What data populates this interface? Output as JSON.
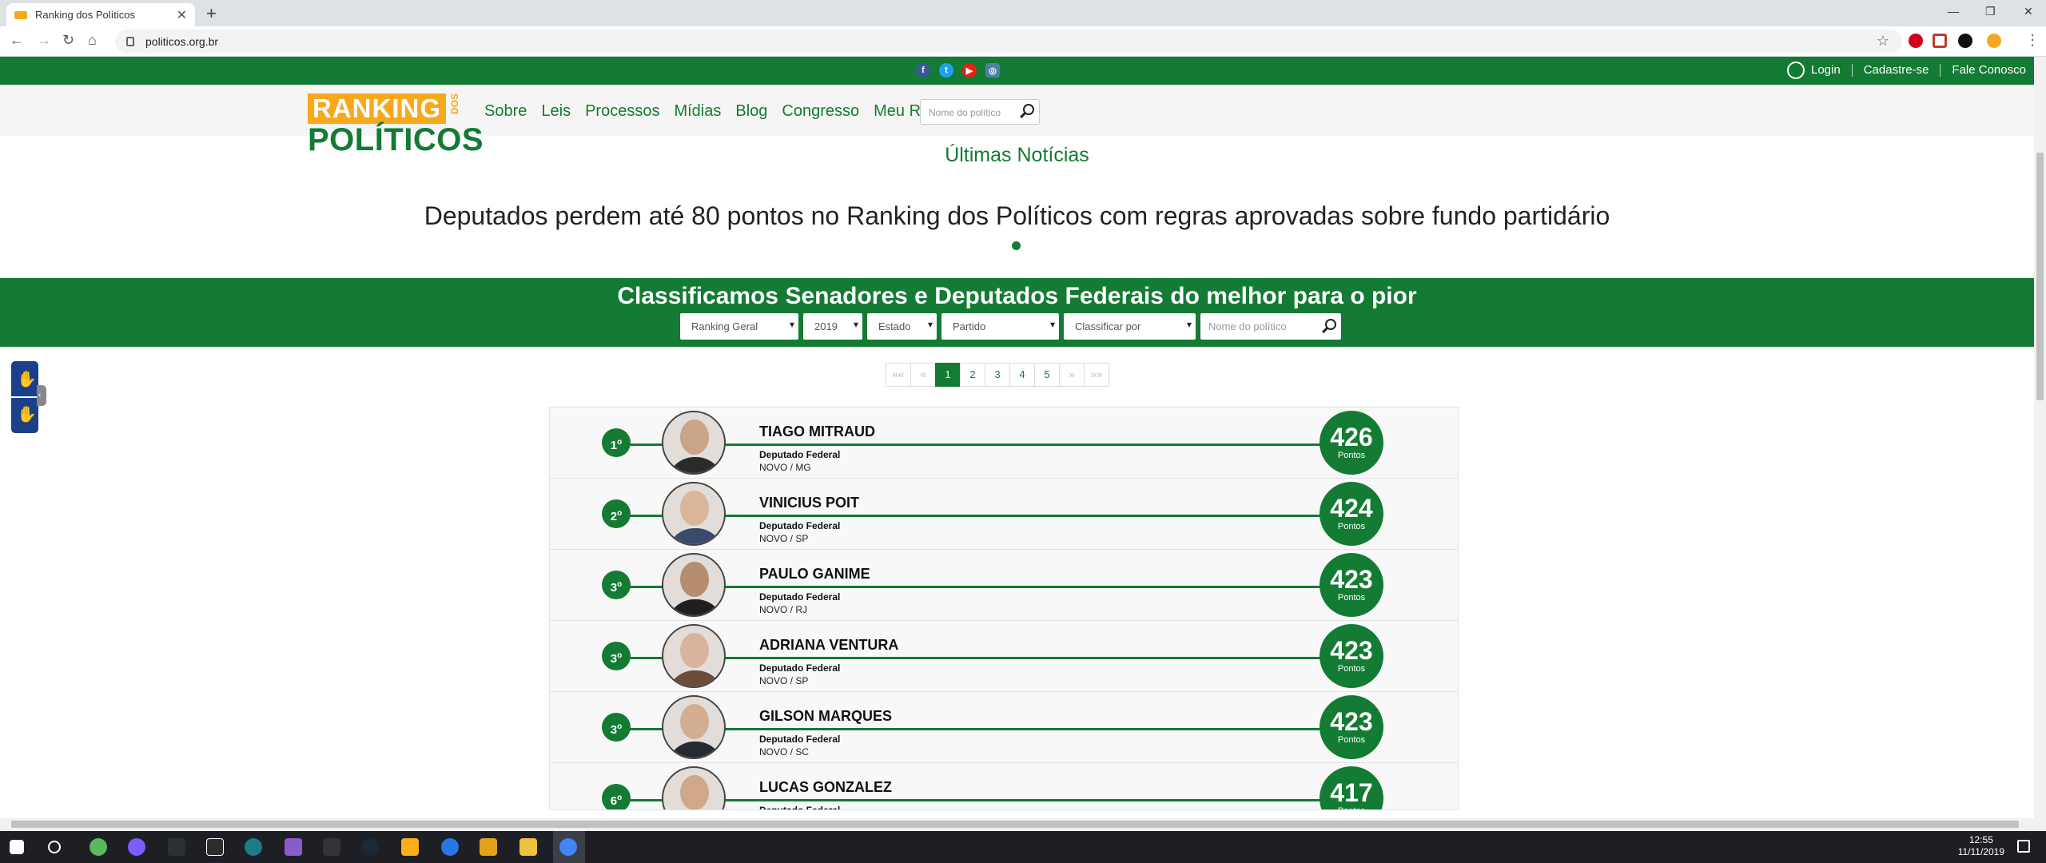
{
  "browser": {
    "tab_title": "Ranking dos Políticos",
    "tab_close": "✕",
    "new_tab": "+",
    "url": "politicos.org.br",
    "back": "←",
    "forward": "→",
    "reload": "↻",
    "home": "⌂",
    "minimize": "—",
    "restore": "❐",
    "close": "✕",
    "star": "☆",
    "menu": "⋮"
  },
  "header": {
    "login": "Login",
    "signup": "Cadastre-se",
    "contact": "Fale Conosco",
    "social": [
      "f",
      "t",
      "▶",
      "◎"
    ]
  },
  "logo": {
    "ranking": "RANKING",
    "dos": "DOS",
    "politicos": "POLÍTICOS"
  },
  "nav": {
    "items": [
      "Sobre",
      "Leis",
      "Processos",
      "Mídias",
      "Blog",
      "Congresso",
      "Meu Ranking"
    ],
    "search_placeholder": "Nome do político"
  },
  "news": {
    "section_title": "Últimas Notícias",
    "headline": "Deputados perdem até 80 pontos no Ranking dos Políticos com regras aprovadas sobre fundo partidário"
  },
  "ranking": {
    "title": "Classificamos Senadores e Deputados Federais do melhor para o pior",
    "filters": {
      "ranking": "Ranking Geral",
      "year": "2019",
      "state": "Estado",
      "party": "Partido",
      "sort": "Classificar por",
      "search_placeholder": "Nome do político"
    },
    "pagination": {
      "first": "««",
      "prev": "«",
      "pages": [
        "1",
        "2",
        "3",
        "4",
        "5"
      ],
      "next": "»",
      "last": "»»",
      "current": "1"
    },
    "points_label": "Pontos",
    "rows": [
      {
        "rank": "1",
        "ord": "o",
        "name": "TIAGO MITRAUD",
        "role": "Deputado Federal",
        "party": "NOVO / MG",
        "score": "426"
      },
      {
        "rank": "2",
        "ord": "o",
        "name": "VINICIUS POIT",
        "role": "Deputado Federal",
        "party": "NOVO / SP",
        "score": "424"
      },
      {
        "rank": "3",
        "ord": "o",
        "name": "PAULO GANIME",
        "role": "Deputado Federal",
        "party": "NOVO / RJ",
        "score": "423"
      },
      {
        "rank": "3",
        "ord": "o",
        "name": "ADRIANA VENTURA",
        "role": "Deputado Federal",
        "party": "NOVO / SP",
        "score": "423"
      },
      {
        "rank": "3",
        "ord": "o",
        "name": "GILSON MARQUES",
        "role": "Deputado Federal",
        "party": "NOVO / SC",
        "score": "423"
      },
      {
        "rank": "6",
        "ord": "o",
        "name": "LUCAS GONZALEZ",
        "role": "Deputado Federal",
        "party": "",
        "score": "417"
      }
    ]
  },
  "taskbar": {
    "time": "12:55",
    "date": "11/11/2019"
  },
  "colors": {
    "brand_green": "#137b33",
    "brand_orange": "#f7a81b"
  }
}
